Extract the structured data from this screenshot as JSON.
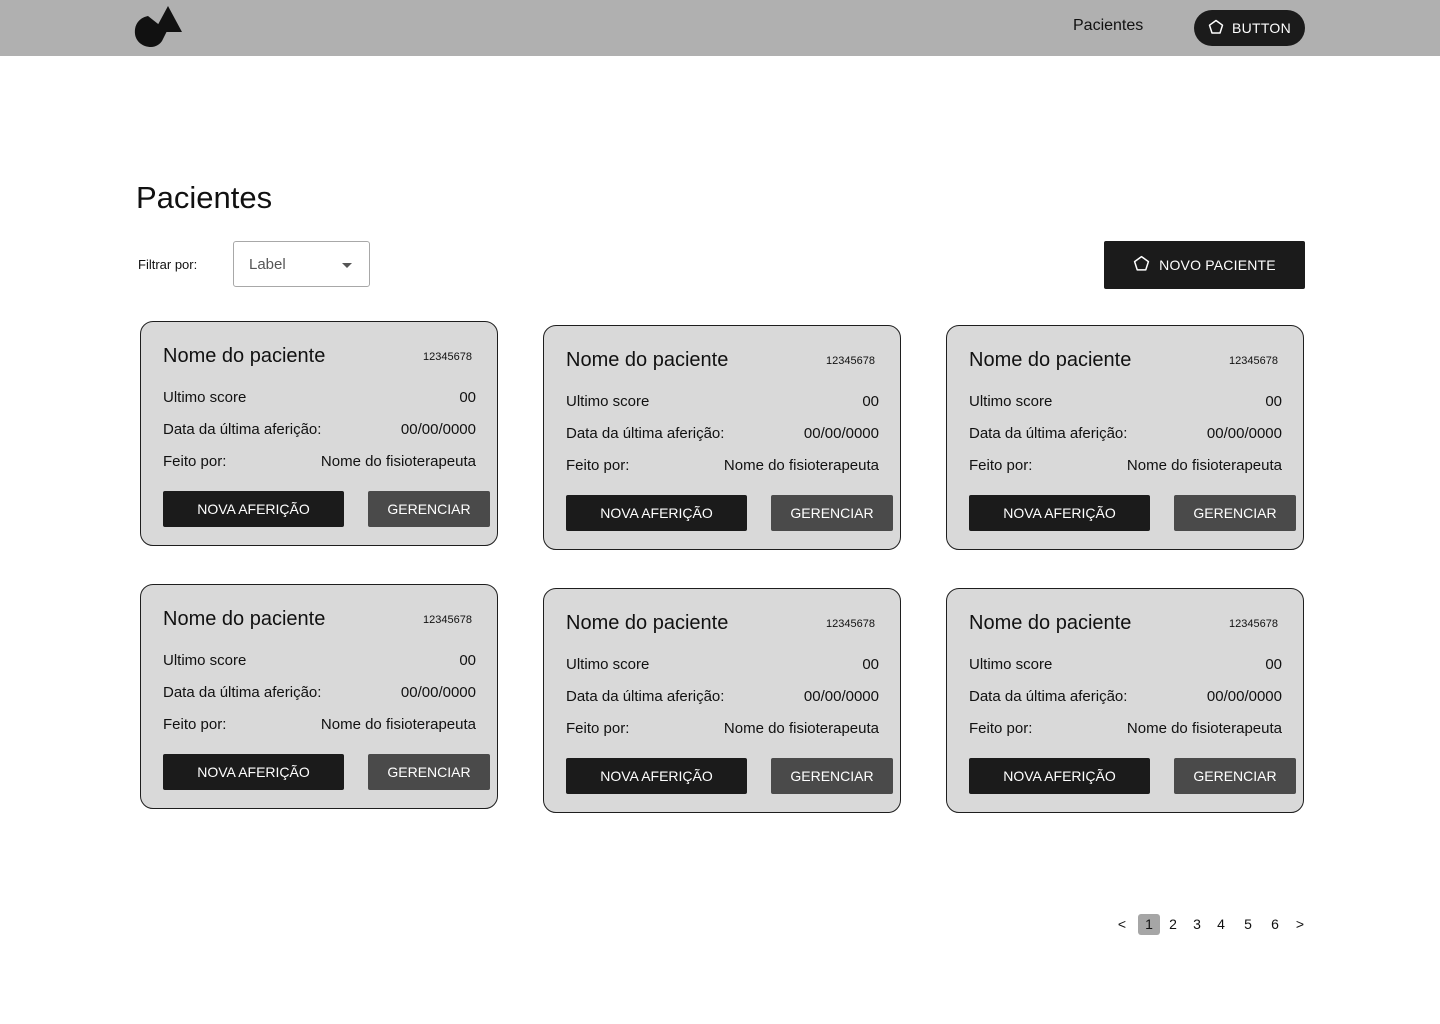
{
  "header": {
    "logo_icon": "triangle-circle-logo-icon",
    "nav_link": "Pacientes",
    "button_label": "BUTTON",
    "button_icon": "pentagon-icon"
  },
  "page": {
    "title": "Pacientes",
    "filter_label": "Filtrar por:",
    "filter_value": "Label",
    "new_button_label": "NOVO PACIENTE",
    "new_button_icon": "pentagon-icon"
  },
  "cards": [
    {
      "name": "Nome do paciente",
      "id": "12345678",
      "score_label": "Ultimo score",
      "score": "00",
      "date_label": "Data da última aferição:",
      "date": "00/00/0000",
      "by_label": "Feito por:",
      "by": "Nome do fisioterapeuta",
      "primary": "NOVA AFERIÇÃO",
      "secondary": "GERENCIAR"
    },
    {
      "name": "Nome do paciente",
      "id": "12345678",
      "score_label": "Ultimo score",
      "score": "00",
      "date_label": "Data da última aferição:",
      "date": "00/00/0000",
      "by_label": "Feito por:",
      "by": "Nome do fisioterapeuta",
      "primary": "NOVA AFERIÇÃO",
      "secondary": "GERENCIAR"
    },
    {
      "name": "Nome do paciente",
      "id": "12345678",
      "score_label": "Ultimo score",
      "score": "00",
      "date_label": "Data da última aferição:",
      "date": "00/00/0000",
      "by_label": "Feito por:",
      "by": "Nome do fisioterapeuta",
      "primary": "NOVA AFERIÇÃO",
      "secondary": "GERENCIAR"
    },
    {
      "name": "Nome do paciente",
      "id": "12345678",
      "score_label": "Ultimo score",
      "score": "00",
      "date_label": "Data da última aferição:",
      "date": "00/00/0000",
      "by_label": "Feito por:",
      "by": "Nome do fisioterapeuta",
      "primary": "NOVA AFERIÇÃO",
      "secondary": "GERENCIAR"
    },
    {
      "name": "Nome do paciente",
      "id": "12345678",
      "score_label": "Ultimo score",
      "score": "00",
      "date_label": "Data da última aferição:",
      "date": "00/00/0000",
      "by_label": "Feito por:",
      "by": "Nome do fisioterapeuta",
      "primary": "NOVA AFERIÇÃO",
      "secondary": "GERENCIAR"
    },
    {
      "name": "Nome do paciente",
      "id": "12345678",
      "score_label": "Ultimo score",
      "score": "00",
      "date_label": "Data da última aferição:",
      "date": "00/00/0000",
      "by_label": "Feito por:",
      "by": "Nome do fisioterapeuta",
      "primary": "NOVA AFERIÇÃO",
      "secondary": "GERENCIAR"
    }
  ],
  "pagination": {
    "prev": "<",
    "pages": [
      "1",
      "2",
      "3",
      "4",
      "5",
      "6"
    ],
    "current": "1",
    "next": ">"
  },
  "colors": {
    "topbar": "#b0b0b0",
    "card_bg": "#d9d9d9",
    "primary_button": "#1b1b1b",
    "secondary_button": "#4a4a4a",
    "active_page": "#a6a6a6"
  }
}
